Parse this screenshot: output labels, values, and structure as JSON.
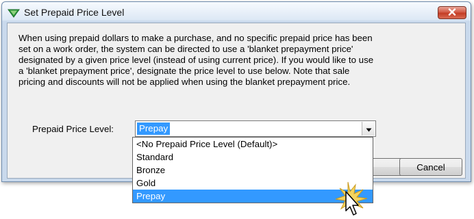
{
  "dialog": {
    "title": "Set Prepaid Price Level",
    "icon": "check-arrow-icon",
    "description_lines": [
      "When using prepaid dollars to make a purchase, and no specific prepaid price has been",
      "set on a work order, the system can be directed to use a 'blanket prepayment price'",
      "designated by a given price level (instead of using current price).  If you would like to use",
      "a 'blanket prepayment price', designate the price level to use below.  Note that sale",
      "pricing and discounts will not be applied when using the blanket prepayment price."
    ],
    "field_label": "Prepaid Price Level:",
    "selected_value": "Prepay",
    "cancel_label": "Cancel",
    "dropdown_options": [
      "<No Prepaid Price Level (Default)>",
      "Standard",
      "Bronze",
      "Gold",
      "Prepay"
    ],
    "highlighted_option": "Prepay"
  },
  "colors": {
    "selection": "#3399ff",
    "close_button": "#c94a32",
    "click_burst": "#f2c43a"
  }
}
